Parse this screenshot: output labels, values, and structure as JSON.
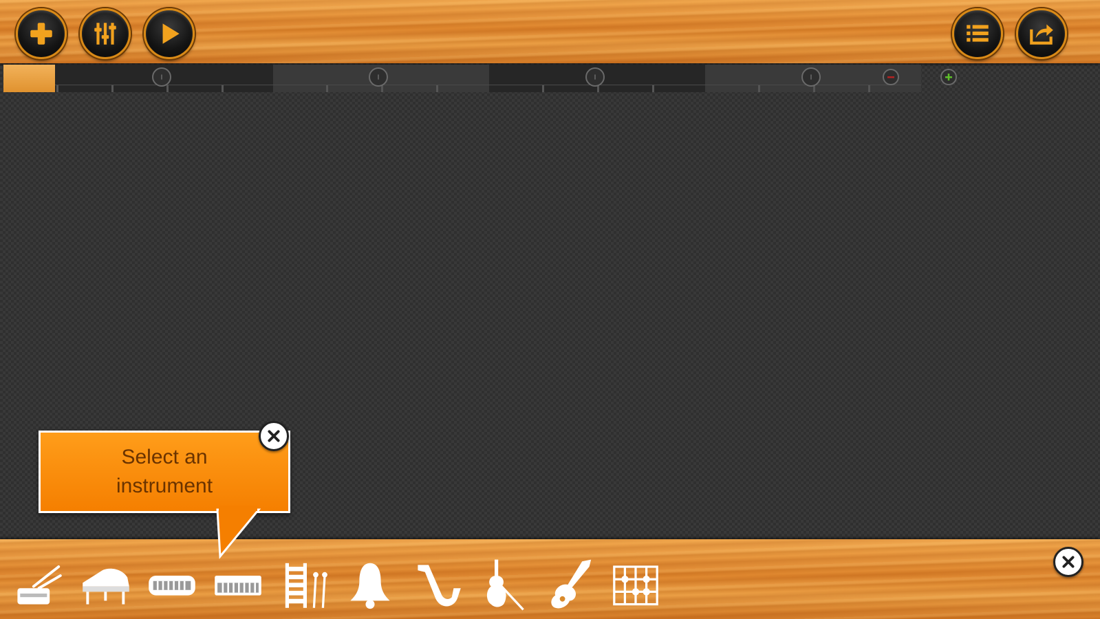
{
  "toolbar": {
    "buttons": [
      "add-icon",
      "mixer-icon",
      "play-icon",
      "list-icon",
      "share-icon"
    ]
  },
  "tooltip": {
    "text": "Select an\ninstrument"
  },
  "instruments": [
    "drum-icon",
    "grand-piano-icon",
    "keyboard-icon",
    "synth-keyboard-icon",
    "xylophone-icon",
    "bell-icon",
    "saxophone-icon",
    "violin-icon",
    "electric-guitar-icon",
    "chord-grid-icon"
  ],
  "colors": {
    "accent": "#f57f00",
    "button_ring": "#d98a17",
    "ruler_dark": "#262626",
    "ruler_light": "#3a3a3a",
    "add_track": "#5fbf2a",
    "remove_track": "#b22222"
  }
}
